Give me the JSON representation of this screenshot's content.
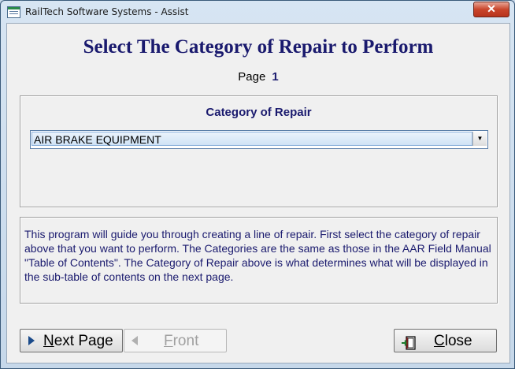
{
  "window": {
    "title": "RailTech Software Systems - Assist",
    "close_glyph": "✕"
  },
  "header": {
    "heading": "Select The Category of Repair to Perform",
    "page_label": "Page",
    "page_number": "1"
  },
  "category": {
    "label": "Category of Repair",
    "selected": "AIR BRAKE EQUIPMENT",
    "arrow_glyph": "▼"
  },
  "description": "This program will guide you through creating a line of repair.  First select the category of repair above that you want to perform.  The Categories are the same as those in the AAR Field Manual \"Table of Contents\".  The Category of Repair above is what determines what will be displayed in the sub-table of contents on the next page.",
  "buttons": {
    "next": {
      "accel": "N",
      "rest": "ext Page",
      "icon": "play-right-icon"
    },
    "front": {
      "accel": "F",
      "rest": "ront",
      "icon": "play-left-icon",
      "enabled": false
    },
    "close": {
      "accel": "C",
      "rest": "lose",
      "icon": "exit-door-icon"
    }
  },
  "colors": {
    "accent_text": "#1a1a6e",
    "title_close": "#c9452b"
  }
}
